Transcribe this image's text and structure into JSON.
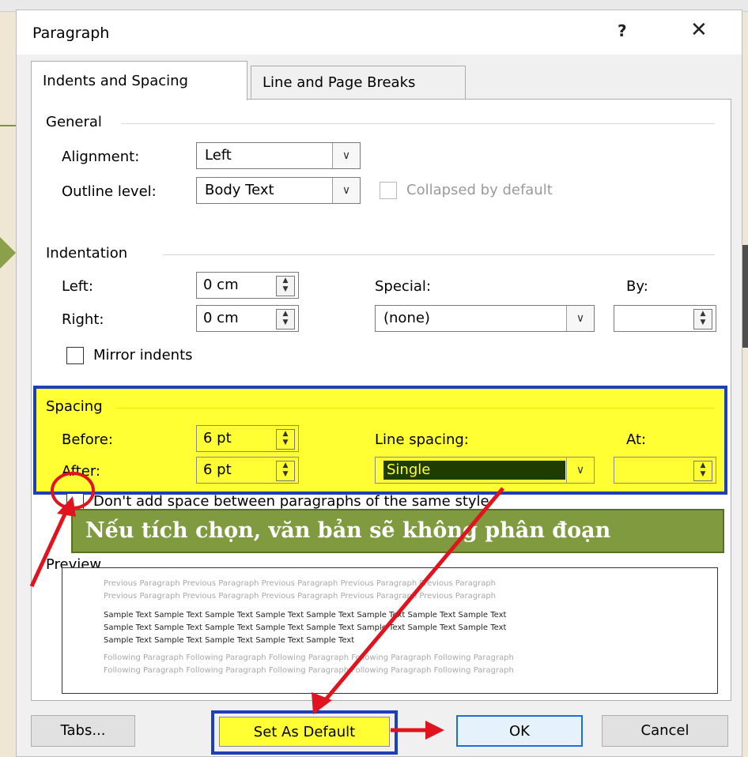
{
  "dialog": {
    "title": "Paragraph",
    "help_label": "?",
    "close_label": "✕"
  },
  "tabs": [
    {
      "label": "Indents and Spacing",
      "underline": "I"
    },
    {
      "label": "Line and Page Breaks",
      "underline": "P"
    }
  ],
  "general": {
    "heading": "General",
    "alignment_label": "Alignment:",
    "alignment_value": "Left",
    "outline_label": "Outline level:",
    "outline_value": "Body Text",
    "collapsed_label": "Collapsed by default"
  },
  "indentation": {
    "heading": "Indentation",
    "left_label": "Left:",
    "left_value": "0 cm",
    "right_label": "Right:",
    "right_value": "0 cm",
    "special_label": "Special:",
    "special_value": "(none)",
    "by_label": "By:",
    "by_value": "",
    "mirror_label": "Mirror indents"
  },
  "spacing": {
    "heading": "Spacing",
    "before_label": "Before:",
    "before_value": "6 pt",
    "after_label": "After:",
    "after_value": "6 pt",
    "line_spacing_label": "Line spacing:",
    "line_spacing_value": "Single",
    "at_label": "At:",
    "at_value": "",
    "dont_add_label": "Don't add space between paragraphs of the same style"
  },
  "preview": {
    "heading": "Preview",
    "previous_lines": [
      "Previous Paragraph Previous Paragraph Previous Paragraph Previous Paragraph Previous Paragraph",
      "Previous Paragraph Previous Paragraph Previous Paragraph Previous Paragraph Previous Paragraph"
    ],
    "sample_lines": [
      "Sample Text Sample Text Sample Text Sample Text Sample Text Sample Text Sample Text Sample Text",
      "Sample Text Sample Text Sample Text Sample Text Sample Text Sample Text Sample Text Sample Text",
      "Sample Text Sample Text Sample Text Sample Text Sample Text"
    ],
    "following_lines": [
      "Following Paragraph Following Paragraph Following Paragraph Following Paragraph Following Paragraph",
      "Following Paragraph Following Paragraph Following Paragraph Following Paragraph Following Paragraph"
    ]
  },
  "callout": {
    "text": "Nếu tích chọn, văn bản sẽ không phân đoạn"
  },
  "buttons": {
    "tabs": "Tabs...",
    "set_default": "Set As Default",
    "ok": "OK",
    "cancel": "Cancel"
  },
  "colors": {
    "highlight": "#ffff33",
    "frame_blue": "#1e3fb8",
    "annotation_red": "#e0141e",
    "callout_green": "#7f9a3f"
  }
}
